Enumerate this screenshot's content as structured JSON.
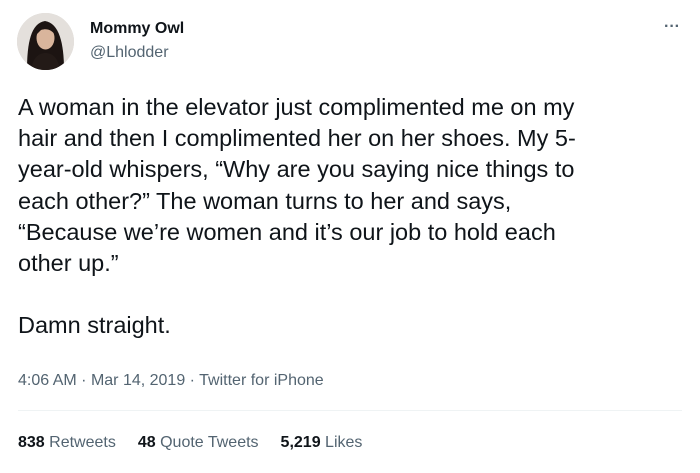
{
  "user": {
    "display_name": "Mommy Owl",
    "handle": "@Lhlodder"
  },
  "more_menu_icon": "more-horizontal-icon",
  "tweet": {
    "text": "A woman in the elevator just complimented me on my\nhair and then I complimented her on her shoes. My 5-\nyear-old whispers, “Why are you saying nice things to\neach other?” The woman turns to her and says,\n“Because we’re women and it’s our job to hold each\nother up.”\n\nDamn straight.",
    "time": "4:06 AM",
    "date": "Mar 14, 2019",
    "source": "Twitter for iPhone",
    "separator": "·"
  },
  "stats": {
    "retweets_count": "838",
    "retweets_label": "Retweets",
    "quote_count": "48",
    "quote_label": "Quote Tweets",
    "likes_count": "5,219",
    "likes_label": "Likes"
  },
  "colors": {
    "primary_text": "#0f1419",
    "secondary_text": "#536471",
    "divider": "#eff3f4"
  }
}
